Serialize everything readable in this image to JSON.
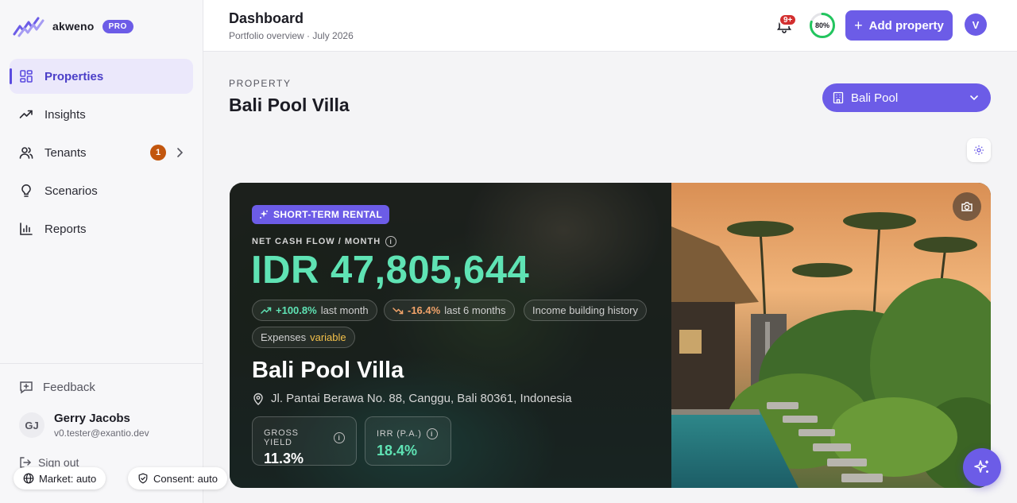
{
  "brand": {
    "name": "akweno",
    "badge": "PRO",
    "accent": "#6c5ce7"
  },
  "sidebar": {
    "items": [
      {
        "label": "Properties",
        "icon": "grid-icon",
        "active": true
      },
      {
        "label": "Insights",
        "icon": "trending-up-icon"
      },
      {
        "label": "Tenants",
        "icon": "users-icon",
        "badge": "1"
      },
      {
        "label": "Scenarios",
        "icon": "lightbulb-icon"
      },
      {
        "label": "Reports",
        "icon": "bar-chart-icon"
      }
    ],
    "feedback": "Feedback",
    "user": {
      "initials": "GJ",
      "name": "Gerry Jacobs",
      "email": "v0.tester@exantio.dev"
    },
    "signout": "Sign out"
  },
  "footer_pills": {
    "market": "Market: auto",
    "consent": "Consent: auto"
  },
  "header": {
    "title": "Dashboard",
    "subtitle": "Portfolio overview · July 2026",
    "notifications_badge": "9+",
    "progress_percent": 80,
    "progress_label": "80%",
    "add_property": "Add property",
    "avatar_initial": "V"
  },
  "page": {
    "eyebrow": "PROPERTY",
    "title": "Bali Pool Villa",
    "selector_value": "Bali Pool"
  },
  "hero": {
    "tag": "SHORT-TERM RENTAL",
    "ncf_label": "NET CASH FLOW / MONTH",
    "ncf_value": "IDR 47,805,644",
    "chips": {
      "last_month_value": "+100.8%",
      "last_month_label": "last month",
      "six_months_value": "-16.4%",
      "six_months_label": "last 6 months",
      "history": "Income building history",
      "expenses_label": "Expenses",
      "expenses_value": "variable"
    },
    "name": "Bali Pool Villa",
    "address": "Jl. Pantai Berawa No. 88, Canggu, Bali 80361, Indonesia",
    "gross_yield_label": "GROSS YIELD",
    "gross_yield_value": "11.3%",
    "irr_label": "IRR (P.A.)",
    "irr_value": "18.4%"
  }
}
